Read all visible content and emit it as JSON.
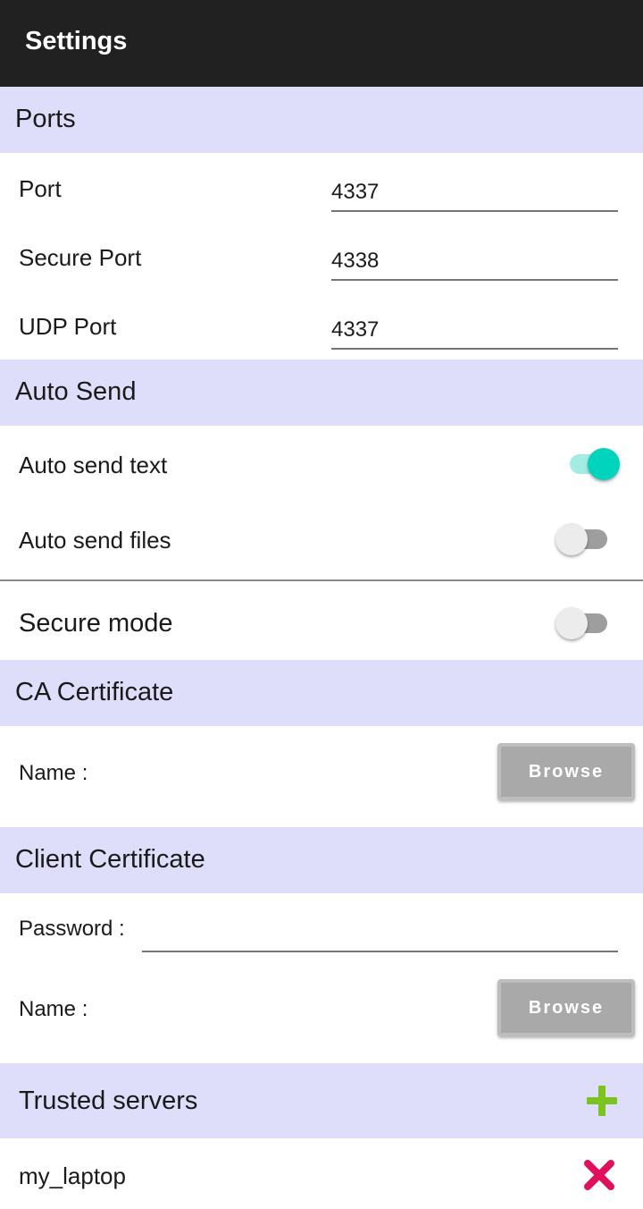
{
  "appbar": {
    "title": "Settings"
  },
  "ports": {
    "section_title": "Ports",
    "port_label": "Port",
    "port_value": "4337",
    "secure_port_label": "Secure Port",
    "secure_port_value": "4338",
    "udp_port_label": "UDP Port",
    "udp_port_value": "4337"
  },
  "auto_send": {
    "section_title": "Auto Send",
    "text_label": "Auto send text",
    "text_enabled": true,
    "files_label": "Auto send files",
    "files_enabled": false
  },
  "secure_mode": {
    "label": "Secure mode",
    "enabled": false
  },
  "ca_certificate": {
    "section_title": "CA Certificate",
    "name_label": "Name :",
    "browse_label": "Browse"
  },
  "client_certificate": {
    "section_title": "Client Certificate",
    "password_label": "Password :",
    "password_value": "",
    "name_label": "Name :",
    "browse_label": "Browse"
  },
  "trusted_servers": {
    "section_title": "Trusted servers",
    "add_icon": "plus-icon",
    "items": [
      {
        "name": "my_laptop",
        "remove_icon": "close-icon"
      }
    ]
  },
  "colors": {
    "appbar": "#212121",
    "section_bg": "#dedefb",
    "switch_on": "#00d4bd",
    "add_green": "#7cc31e",
    "remove_red": "#e0105c"
  }
}
